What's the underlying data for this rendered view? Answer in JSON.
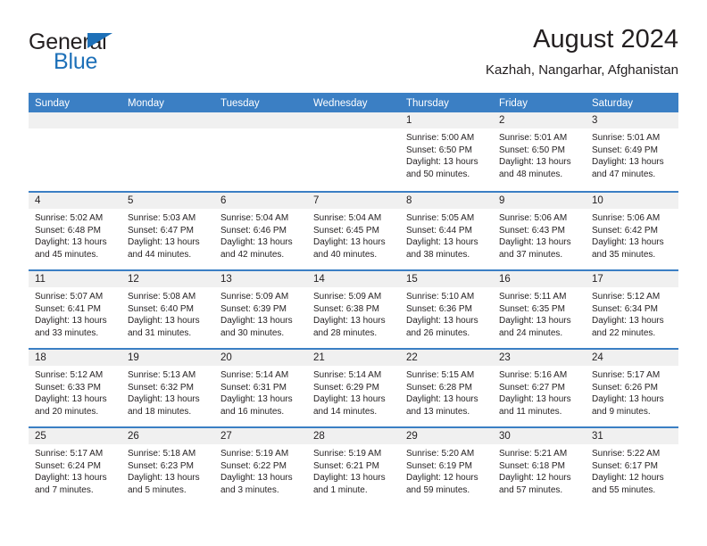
{
  "logo": {
    "primary_text": "General",
    "secondary_text": "Blue",
    "accent_color": "#1d70b8",
    "triangle_icon": "triangle-icon"
  },
  "header": {
    "title": "August 2024",
    "subtitle": "Kazhah, Nangarhar, Afghanistan"
  },
  "calendar": {
    "header_bg": "#3b7fc4",
    "day_band_bg": "#f0f0f0",
    "weekdays": [
      "Sunday",
      "Monday",
      "Tuesday",
      "Wednesday",
      "Thursday",
      "Friday",
      "Saturday"
    ],
    "weeks": [
      [
        {
          "day": "",
          "empty": true
        },
        {
          "day": "",
          "empty": true
        },
        {
          "day": "",
          "empty": true
        },
        {
          "day": "",
          "empty": true
        },
        {
          "day": "1",
          "sunrise": "Sunrise: 5:00 AM",
          "sunset": "Sunset: 6:50 PM",
          "daylight_1": "Daylight: 13 hours",
          "daylight_2": "and 50 minutes."
        },
        {
          "day": "2",
          "sunrise": "Sunrise: 5:01 AM",
          "sunset": "Sunset: 6:50 PM",
          "daylight_1": "Daylight: 13 hours",
          "daylight_2": "and 48 minutes."
        },
        {
          "day": "3",
          "sunrise": "Sunrise: 5:01 AM",
          "sunset": "Sunset: 6:49 PM",
          "daylight_1": "Daylight: 13 hours",
          "daylight_2": "and 47 minutes."
        }
      ],
      [
        {
          "day": "4",
          "sunrise": "Sunrise: 5:02 AM",
          "sunset": "Sunset: 6:48 PM",
          "daylight_1": "Daylight: 13 hours",
          "daylight_2": "and 45 minutes."
        },
        {
          "day": "5",
          "sunrise": "Sunrise: 5:03 AM",
          "sunset": "Sunset: 6:47 PM",
          "daylight_1": "Daylight: 13 hours",
          "daylight_2": "and 44 minutes."
        },
        {
          "day": "6",
          "sunrise": "Sunrise: 5:04 AM",
          "sunset": "Sunset: 6:46 PM",
          "daylight_1": "Daylight: 13 hours",
          "daylight_2": "and 42 minutes."
        },
        {
          "day": "7",
          "sunrise": "Sunrise: 5:04 AM",
          "sunset": "Sunset: 6:45 PM",
          "daylight_1": "Daylight: 13 hours",
          "daylight_2": "and 40 minutes."
        },
        {
          "day": "8",
          "sunrise": "Sunrise: 5:05 AM",
          "sunset": "Sunset: 6:44 PM",
          "daylight_1": "Daylight: 13 hours",
          "daylight_2": "and 38 minutes."
        },
        {
          "day": "9",
          "sunrise": "Sunrise: 5:06 AM",
          "sunset": "Sunset: 6:43 PM",
          "daylight_1": "Daylight: 13 hours",
          "daylight_2": "and 37 minutes."
        },
        {
          "day": "10",
          "sunrise": "Sunrise: 5:06 AM",
          "sunset": "Sunset: 6:42 PM",
          "daylight_1": "Daylight: 13 hours",
          "daylight_2": "and 35 minutes."
        }
      ],
      [
        {
          "day": "11",
          "sunrise": "Sunrise: 5:07 AM",
          "sunset": "Sunset: 6:41 PM",
          "daylight_1": "Daylight: 13 hours",
          "daylight_2": "and 33 minutes."
        },
        {
          "day": "12",
          "sunrise": "Sunrise: 5:08 AM",
          "sunset": "Sunset: 6:40 PM",
          "daylight_1": "Daylight: 13 hours",
          "daylight_2": "and 31 minutes."
        },
        {
          "day": "13",
          "sunrise": "Sunrise: 5:09 AM",
          "sunset": "Sunset: 6:39 PM",
          "daylight_1": "Daylight: 13 hours",
          "daylight_2": "and 30 minutes."
        },
        {
          "day": "14",
          "sunrise": "Sunrise: 5:09 AM",
          "sunset": "Sunset: 6:38 PM",
          "daylight_1": "Daylight: 13 hours",
          "daylight_2": "and 28 minutes."
        },
        {
          "day": "15",
          "sunrise": "Sunrise: 5:10 AM",
          "sunset": "Sunset: 6:36 PM",
          "daylight_1": "Daylight: 13 hours",
          "daylight_2": "and 26 minutes."
        },
        {
          "day": "16",
          "sunrise": "Sunrise: 5:11 AM",
          "sunset": "Sunset: 6:35 PM",
          "daylight_1": "Daylight: 13 hours",
          "daylight_2": "and 24 minutes."
        },
        {
          "day": "17",
          "sunrise": "Sunrise: 5:12 AM",
          "sunset": "Sunset: 6:34 PM",
          "daylight_1": "Daylight: 13 hours",
          "daylight_2": "and 22 minutes."
        }
      ],
      [
        {
          "day": "18",
          "sunrise": "Sunrise: 5:12 AM",
          "sunset": "Sunset: 6:33 PM",
          "daylight_1": "Daylight: 13 hours",
          "daylight_2": "and 20 minutes."
        },
        {
          "day": "19",
          "sunrise": "Sunrise: 5:13 AM",
          "sunset": "Sunset: 6:32 PM",
          "daylight_1": "Daylight: 13 hours",
          "daylight_2": "and 18 minutes."
        },
        {
          "day": "20",
          "sunrise": "Sunrise: 5:14 AM",
          "sunset": "Sunset: 6:31 PM",
          "daylight_1": "Daylight: 13 hours",
          "daylight_2": "and 16 minutes."
        },
        {
          "day": "21",
          "sunrise": "Sunrise: 5:14 AM",
          "sunset": "Sunset: 6:29 PM",
          "daylight_1": "Daylight: 13 hours",
          "daylight_2": "and 14 minutes."
        },
        {
          "day": "22",
          "sunrise": "Sunrise: 5:15 AM",
          "sunset": "Sunset: 6:28 PM",
          "daylight_1": "Daylight: 13 hours",
          "daylight_2": "and 13 minutes."
        },
        {
          "day": "23",
          "sunrise": "Sunrise: 5:16 AM",
          "sunset": "Sunset: 6:27 PM",
          "daylight_1": "Daylight: 13 hours",
          "daylight_2": "and 11 minutes."
        },
        {
          "day": "24",
          "sunrise": "Sunrise: 5:17 AM",
          "sunset": "Sunset: 6:26 PM",
          "daylight_1": "Daylight: 13 hours",
          "daylight_2": "and 9 minutes."
        }
      ],
      [
        {
          "day": "25",
          "sunrise": "Sunrise: 5:17 AM",
          "sunset": "Sunset: 6:24 PM",
          "daylight_1": "Daylight: 13 hours",
          "daylight_2": "and 7 minutes."
        },
        {
          "day": "26",
          "sunrise": "Sunrise: 5:18 AM",
          "sunset": "Sunset: 6:23 PM",
          "daylight_1": "Daylight: 13 hours",
          "daylight_2": "and 5 minutes."
        },
        {
          "day": "27",
          "sunrise": "Sunrise: 5:19 AM",
          "sunset": "Sunset: 6:22 PM",
          "daylight_1": "Daylight: 13 hours",
          "daylight_2": "and 3 minutes."
        },
        {
          "day": "28",
          "sunrise": "Sunrise: 5:19 AM",
          "sunset": "Sunset: 6:21 PM",
          "daylight_1": "Daylight: 13 hours",
          "daylight_2": "and 1 minute."
        },
        {
          "day": "29",
          "sunrise": "Sunrise: 5:20 AM",
          "sunset": "Sunset: 6:19 PM",
          "daylight_1": "Daylight: 12 hours",
          "daylight_2": "and 59 minutes."
        },
        {
          "day": "30",
          "sunrise": "Sunrise: 5:21 AM",
          "sunset": "Sunset: 6:18 PM",
          "daylight_1": "Daylight: 12 hours",
          "daylight_2": "and 57 minutes."
        },
        {
          "day": "31",
          "sunrise": "Sunrise: 5:22 AM",
          "sunset": "Sunset: 6:17 PM",
          "daylight_1": "Daylight: 12 hours",
          "daylight_2": "and 55 minutes."
        }
      ]
    ]
  }
}
